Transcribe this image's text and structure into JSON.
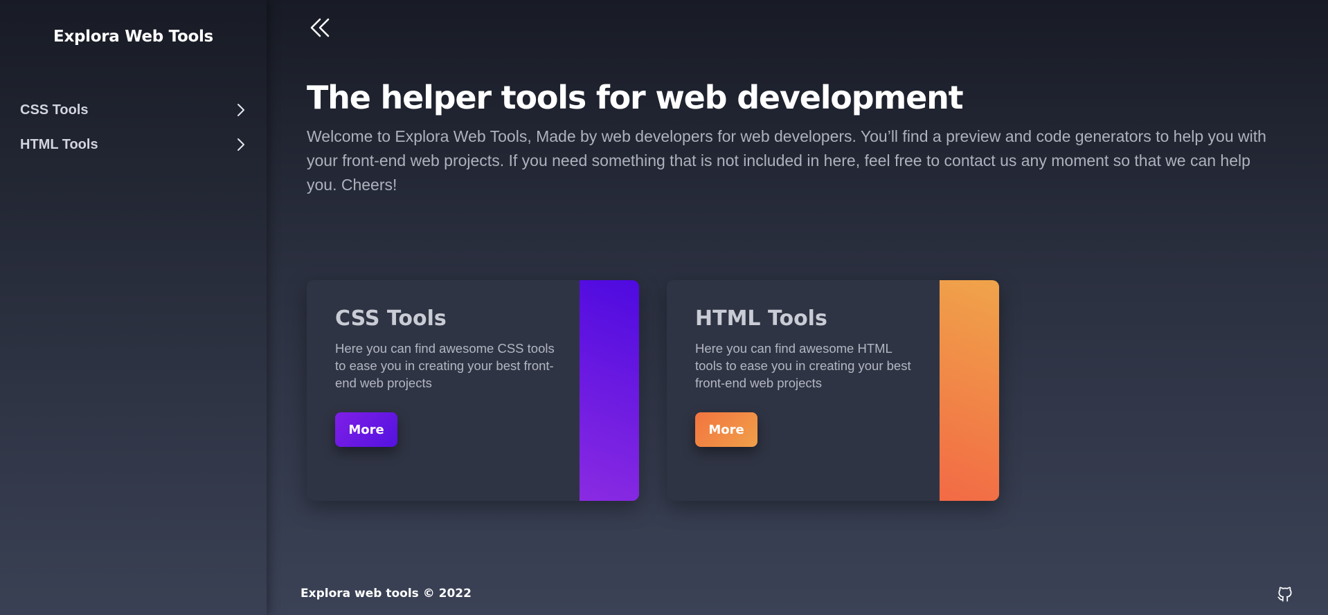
{
  "sidebar": {
    "brand": "Explora Web Tools",
    "items": [
      {
        "label": "CSS Tools",
        "icon": "chevron-right-icon"
      },
      {
        "label": "HTML Tools",
        "icon": "chevron-right-icon"
      }
    ]
  },
  "header": {
    "collapse_icon": "double-chevron-left-icon"
  },
  "hero": {
    "title": "The helper tools for web development",
    "description": "Welcome to Explora Web Tools, Made by web developers for web developers. You’ll find a preview and code generators to help you with your front-end web projects. If you need something that is not included in here, feel free to contact us any moment so that we can help you. Cheers!"
  },
  "cards": [
    {
      "title": "CSS Tools",
      "description": "Here you can find awesome CSS tools to ease you in creating your best front-end web projects",
      "button_label": "More",
      "accent_colors": [
        "#8a2be2",
        "#4e0ae0"
      ]
    },
    {
      "title": "HTML Tools",
      "description": "Here you can find awesome HTML tools to ease you in creating your best front-end web projects",
      "button_label": "More",
      "accent_colors": [
        "#f26a45",
        "#f0a44a"
      ]
    }
  ],
  "footer": {
    "copyright": "Explora web tools © 2022",
    "icon": "github-icon"
  }
}
